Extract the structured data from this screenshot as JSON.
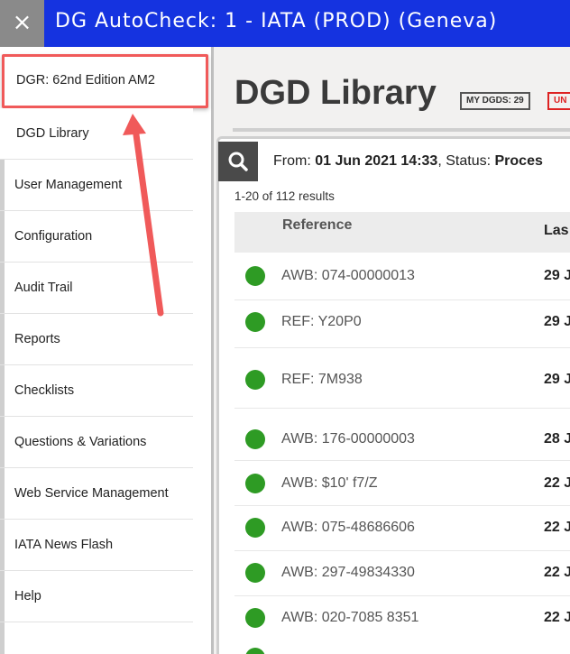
{
  "topbar": {
    "close_icon": "×",
    "title": "DG AutoCheck: 1 - IATA (PROD) (Geneva)"
  },
  "sidebar": {
    "items": [
      {
        "label": "DGR: 62nd Edition AM2"
      },
      {
        "label": "DGD Library"
      },
      {
        "label": "User Management"
      },
      {
        "label": "Configuration"
      },
      {
        "label": "Audit Trail"
      },
      {
        "label": "Reports"
      },
      {
        "label": "Checklists"
      },
      {
        "label": "Questions & Variations"
      },
      {
        "label": "Web Service Management"
      },
      {
        "label": "IATA News Flash"
      },
      {
        "label": "Help"
      }
    ]
  },
  "main": {
    "page_title": "DGD Library",
    "badges": {
      "my_dgds": "MY DGDS: 29",
      "un": "UN"
    },
    "filter": {
      "from_label": "From:",
      "from_value": "01 Jun 2021 14:33",
      "separator": ",",
      "status_label": "Status:",
      "status_value": "Proces"
    },
    "results_text": "1-20 of 112 results",
    "table": {
      "headers": {
        "reference": "Reference",
        "last": "Las"
      },
      "rows": [
        {
          "reference": "AWB: 074-00000013",
          "date": "29 J"
        },
        {
          "reference": "REF: Y20P0",
          "date": "29 J"
        },
        {
          "reference": "REF: 7M938",
          "date": "29 J"
        },
        {
          "reference": "AWB: 176-00000003",
          "date": "28 J"
        },
        {
          "reference": "AWB: $10' f7/Z",
          "date": "22 J"
        },
        {
          "reference": "AWB: 075-48686606",
          "date": "22 J"
        },
        {
          "reference": "AWB: 297-49834330",
          "date": "22 J"
        },
        {
          "reference": "AWB: 020-7085 8351",
          "date": "22 J"
        }
      ]
    }
  },
  "colors": {
    "topbar": "#1533e0",
    "highlight_box": "#f05a5a",
    "status_dot": "#2e9b24",
    "arrow": "#f05a5a"
  }
}
